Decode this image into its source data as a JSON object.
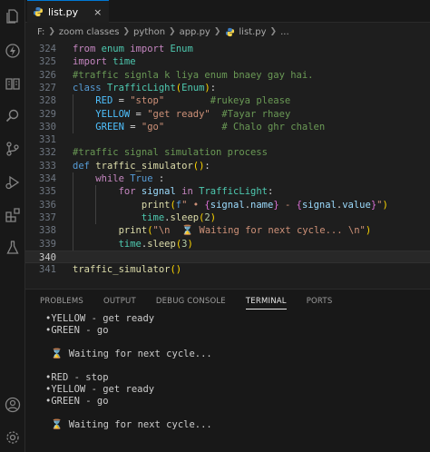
{
  "tab": {
    "label": "list.py",
    "close": "×"
  },
  "breadcrumb": [
    "F:",
    "zoom classes",
    "python",
    "app.py",
    "list.py",
    "..."
  ],
  "editor": {
    "lines": [
      {
        "num": "324",
        "tokens": [
          [
            "kw",
            "from"
          ],
          [
            "pl",
            " "
          ],
          [
            "cls",
            "enum"
          ],
          [
            "pl",
            " "
          ],
          [
            "kw",
            "import"
          ],
          [
            "pl",
            " "
          ],
          [
            "cls",
            "Enum"
          ]
        ]
      },
      {
        "num": "325",
        "tokens": [
          [
            "kw",
            "import"
          ],
          [
            "pl",
            " "
          ],
          [
            "cls",
            "time"
          ]
        ]
      },
      {
        "num": "326",
        "tokens": [
          [
            "com",
            "#traffic signla k liya enum bnaey gay hai."
          ]
        ]
      },
      {
        "num": "327",
        "tokens": [
          [
            "kb",
            "class"
          ],
          [
            "pl",
            " "
          ],
          [
            "cls",
            "TrafficLight"
          ],
          [
            "br1",
            "("
          ],
          [
            "cls",
            "Enum"
          ],
          [
            "br1",
            ")"
          ],
          [
            "pl",
            ":"
          ]
        ]
      },
      {
        "num": "328",
        "tokens": [
          [
            "pl",
            "    "
          ],
          [
            "const",
            "RED"
          ],
          [
            "pl",
            " = "
          ],
          [
            "str",
            "\"stop\""
          ],
          [
            "pl",
            "        "
          ],
          [
            "com",
            "#rukeya please"
          ]
        ]
      },
      {
        "num": "329",
        "tokens": [
          [
            "pl",
            "    "
          ],
          [
            "const",
            "YELLOW"
          ],
          [
            "pl",
            " = "
          ],
          [
            "str",
            "\"get ready\""
          ],
          [
            "pl",
            "  "
          ],
          [
            "com",
            "#Tayar rhaey"
          ]
        ]
      },
      {
        "num": "330",
        "tokens": [
          [
            "pl",
            "    "
          ],
          [
            "const",
            "GREEN"
          ],
          [
            "pl",
            " = "
          ],
          [
            "str",
            "\"go\""
          ],
          [
            "pl",
            "          "
          ],
          [
            "com",
            "# Chalo ghr chalen"
          ]
        ]
      },
      {
        "num": "331",
        "tokens": []
      },
      {
        "num": "332",
        "tokens": [
          [
            "com",
            "#traffic signal simulation process"
          ]
        ]
      },
      {
        "num": "333",
        "tokens": [
          [
            "kb",
            "def"
          ],
          [
            "pl",
            " "
          ],
          [
            "fn",
            "traffic_simulator"
          ],
          [
            "br1",
            "()"
          ],
          [
            "pl",
            ":"
          ]
        ]
      },
      {
        "num": "334",
        "tokens": [
          [
            "pl",
            "    "
          ],
          [
            "kw",
            "while"
          ],
          [
            "pl",
            " "
          ],
          [
            "kb",
            "True"
          ],
          [
            "pl",
            " :"
          ]
        ]
      },
      {
        "num": "335",
        "tokens": [
          [
            "pl",
            "        "
          ],
          [
            "kw",
            "for"
          ],
          [
            "pl",
            " "
          ],
          [
            "var",
            "signal"
          ],
          [
            "pl",
            " "
          ],
          [
            "kw",
            "in"
          ],
          [
            "pl",
            " "
          ],
          [
            "cls",
            "TrafficLight"
          ],
          [
            "pl",
            ":"
          ]
        ]
      },
      {
        "num": "336",
        "tokens": [
          [
            "pl",
            "            "
          ],
          [
            "fn",
            "print"
          ],
          [
            "br1",
            "("
          ],
          [
            "kb",
            "f"
          ],
          [
            "str",
            "\" • "
          ],
          [
            "br2",
            "{"
          ],
          [
            "var",
            "signal"
          ],
          [
            "pl",
            "."
          ],
          [
            "var",
            "name"
          ],
          [
            "br2",
            "}"
          ],
          [
            "str",
            " - "
          ],
          [
            "br2",
            "{"
          ],
          [
            "var",
            "signal"
          ],
          [
            "pl",
            "."
          ],
          [
            "var",
            "value"
          ],
          [
            "br2",
            "}"
          ],
          [
            "str",
            "\""
          ],
          [
            "br1",
            ")"
          ]
        ]
      },
      {
        "num": "337",
        "tokens": [
          [
            "pl",
            "            "
          ],
          [
            "cls",
            "time"
          ],
          [
            "pl",
            "."
          ],
          [
            "fn",
            "sleep"
          ],
          [
            "br1",
            "("
          ],
          [
            "num",
            "2"
          ],
          [
            "br1",
            ")"
          ]
        ]
      },
      {
        "num": "338",
        "tokens": [
          [
            "pl",
            "        "
          ],
          [
            "fn",
            "print"
          ],
          [
            "br1",
            "("
          ],
          [
            "str",
            "\"\\n  ⌛ Waiting for next cycle... \\n\""
          ],
          [
            "br1",
            ")"
          ]
        ]
      },
      {
        "num": "339",
        "tokens": [
          [
            "pl",
            "        "
          ],
          [
            "cls",
            "time"
          ],
          [
            "pl",
            "."
          ],
          [
            "fn",
            "sleep"
          ],
          [
            "br1",
            "("
          ],
          [
            "num",
            "3"
          ],
          [
            "br1",
            ")"
          ]
        ]
      },
      {
        "num": "340",
        "tokens": [],
        "active": true
      },
      {
        "num": "341",
        "tokens": [
          [
            "fn",
            "traffic_simulator"
          ],
          [
            "br1",
            "()"
          ]
        ]
      }
    ]
  },
  "panel": {
    "tabs": [
      "PROBLEMS",
      "OUTPUT",
      "DEBUG CONSOLE",
      "TERMINAL",
      "PORTS"
    ],
    "active_tab": "TERMINAL",
    "terminal_lines": [
      "•YELLOW - get ready",
      "•GREEN - go",
      "",
      " ⌛ Waiting for next cycle...",
      "",
      "•RED - stop",
      "•YELLOW - get ready",
      "•GREEN - go",
      "",
      " ⌛ Waiting for next cycle..."
    ]
  },
  "activity_icons": [
    "files-icon",
    "lightning-icon",
    "book-icon",
    "search-icon",
    "source-control-icon",
    "run-debug-icon",
    "extensions-icon",
    "flask-icon",
    "account-icon",
    "settings-gear-icon"
  ],
  "colors": {
    "accent": "#0078d4",
    "editor_bg": "#1e1e1e",
    "sidebar_bg": "#181818"
  }
}
